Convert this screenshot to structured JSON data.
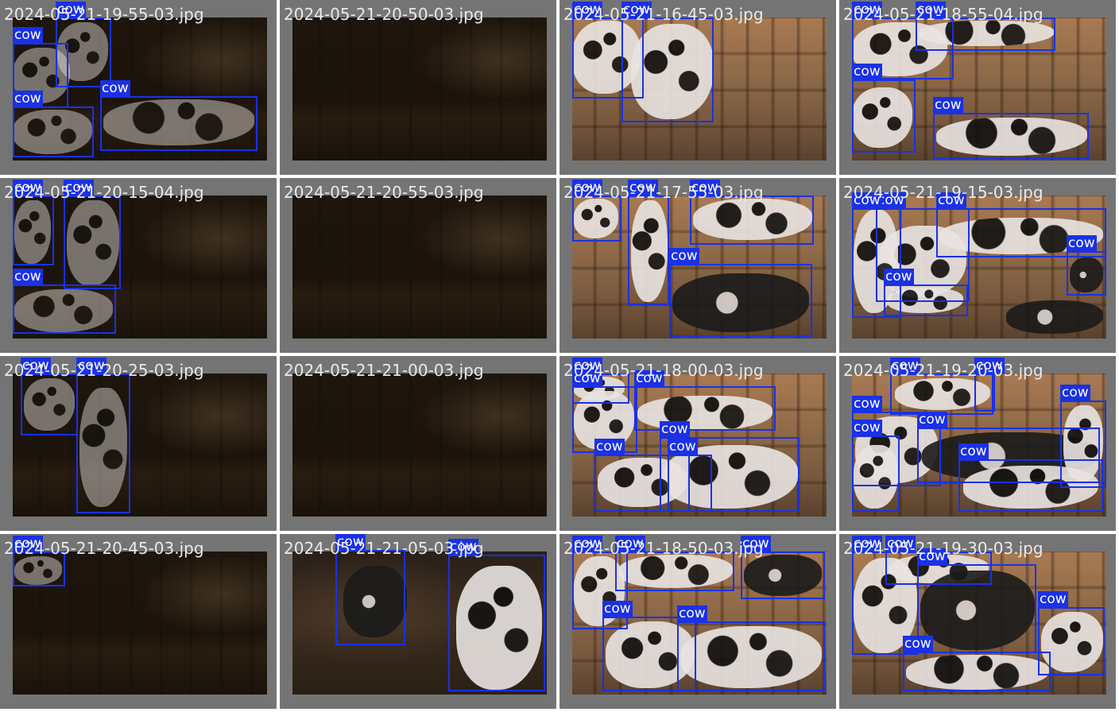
{
  "colors": {
    "box": "#1a31e6",
    "label_text": "#ffffff",
    "tile_background": "#747474",
    "filename_text": "#eaeaea"
  },
  "class_label": "cow",
  "tiles": [
    {
      "filename": "2024-05-21-19-55-03.jpg",
      "scene": "night",
      "detections": 4
    },
    {
      "filename": "2024-05-21-20-50-03.jpg",
      "scene": "night",
      "detections": 0
    },
    {
      "filename": "2024-05-21-16-45-03.jpg",
      "scene": "day",
      "detections": 2
    },
    {
      "filename": "2024-05-21-18-55-04.jpg",
      "scene": "day",
      "detections": 4
    },
    {
      "filename": "2024-05-21-20-15-04.jpg",
      "scene": "night",
      "detections": 3
    },
    {
      "filename": "2024-05-21-20-55-03.jpg",
      "scene": "night",
      "detections": 0
    },
    {
      "filename": "2024-05-21-17-55-03.jpg",
      "scene": "day",
      "detections": 4
    },
    {
      "filename": "2024-05-21-19-15-03.jpg",
      "scene": "day",
      "detections": 5
    },
    {
      "filename": "2024-05-21-20-25-03.jpg",
      "scene": "night",
      "detections": 2
    },
    {
      "filename": "2024-05-21-21-00-03.jpg",
      "scene": "night",
      "detections": 0
    },
    {
      "filename": "2024-05-21-18-00-03.jpg",
      "scene": "day",
      "detections": 6
    },
    {
      "filename": "2024-05-21-19-20-03.jpg",
      "scene": "day",
      "detections": 7
    },
    {
      "filename": "2024-05-21-20-45-03.jpg",
      "scene": "night",
      "detections": 1
    },
    {
      "filename": "2024-05-21-21-05-03.jpg",
      "scene": "dim",
      "detections": 2
    },
    {
      "filename": "2024-05-21-18-50-03.jpg",
      "scene": "day",
      "detections": 5
    },
    {
      "filename": "2024-05-21-19-30-03.jpg",
      "scene": "day",
      "detections": 5
    }
  ]
}
